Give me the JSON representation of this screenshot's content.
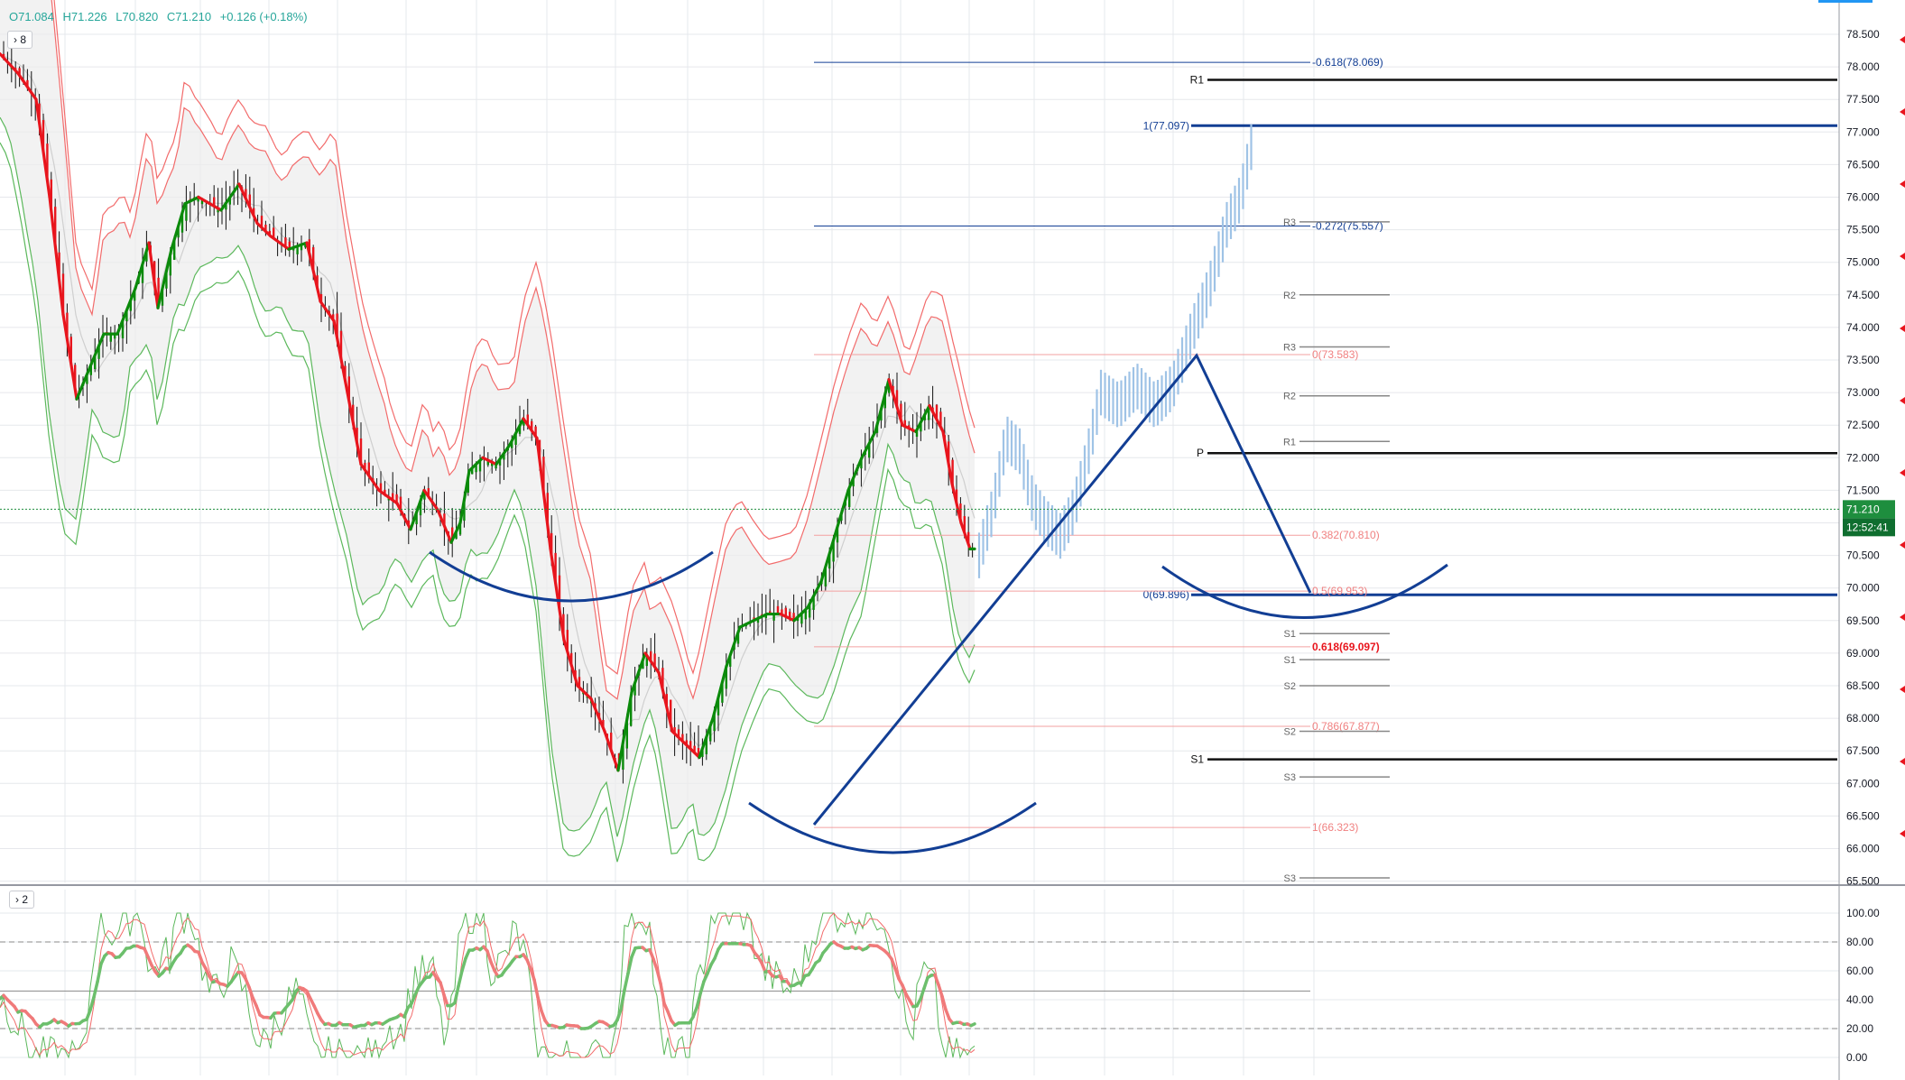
{
  "header": {
    "open": "O71.084",
    "high": "H71.226",
    "low": "L70.820",
    "close": "C71.210",
    "change": "+0.126 (+0.18%)"
  },
  "panes": {
    "main_toggle": "› 8",
    "osc_toggle": "› 2"
  },
  "colors": {
    "up": "#0a8a0a",
    "down": "#e8151d",
    "band_upper": "#f26b6b",
    "band_lower": "#5cb85c",
    "annot": "#123e94",
    "projection": "#9fc3e6",
    "price_tag": "#1e8e3e"
  },
  "price_scale": {
    "labels": [
      "78.500",
      "78.000",
      "77.500",
      "77.000",
      "76.500",
      "76.000",
      "75.500",
      "75.000",
      "74.500",
      "74.000",
      "73.500",
      "73.000",
      "72.500",
      "72.000",
      "71.500",
      "71.000",
      "70.500",
      "70.000",
      "69.500",
      "69.000",
      "68.500",
      "68.000",
      "67.500",
      "67.000",
      "66.500",
      "66.000",
      "65.500"
    ],
    "last_price": "71.210",
    "countdown": "12:52:41"
  },
  "osc_scale": {
    "labels": [
      "100.00",
      "80.00",
      "60.00",
      "40.00",
      "20.00",
      "0.00"
    ]
  },
  "annotations": {
    "fib_ext": [
      {
        "label": "-0.618(78.069)",
        "value": 78.069
      },
      {
        "label": "1(77.097)",
        "value": 77.097
      },
      {
        "label": "-0.272(75.557)",
        "value": 75.557
      },
      {
        "label": "0(69.896)",
        "value": 69.896
      }
    ],
    "fib_ret": [
      {
        "label": "0(73.583)",
        "value": 73.583
      },
      {
        "label": "0.382(70.810)",
        "value": 70.81
      },
      {
        "label": "0.5(69.953)",
        "value": 69.953
      },
      {
        "label": "0.618(69.097)",
        "value": 69.097
      },
      {
        "label": "0.786(67.877)",
        "value": 67.877
      },
      {
        "label": "1(66.323)",
        "value": 66.323
      }
    ],
    "pivots_major": [
      {
        "label": "R1",
        "value": 77.8
      },
      {
        "label": "P",
        "value": 72.07
      },
      {
        "label": "S1",
        "value": 67.37
      }
    ],
    "pivots_minor": [
      {
        "label": "R3",
        "value": 75.62
      },
      {
        "label": "R2",
        "value": 74.5
      },
      {
        "label": "R3",
        "value": 73.7
      },
      {
        "label": "R2",
        "value": 72.95
      },
      {
        "label": "R1",
        "value": 72.25
      },
      {
        "label": "S1",
        "value": 69.3
      },
      {
        "label": "S1",
        "value": 68.9
      },
      {
        "label": "S2",
        "value": 68.5
      },
      {
        "label": "S2",
        "value": 67.8
      },
      {
        "label": "S3",
        "value": 67.1
      },
      {
        "label": "S3",
        "value": 65.55
      }
    ]
  },
  "chart_data": [
    {
      "type": "candlestick",
      "title": "",
      "ylim": [
        65.5,
        78.6
      ],
      "last_price": 71.21,
      "grid": true,
      "close_path": [
        [
          0,
          78.2
        ],
        [
          20,
          77.9
        ],
        [
          40,
          77.5
        ],
        [
          55,
          76.0
        ],
        [
          70,
          74.2
        ],
        [
          85,
          72.9
        ],
        [
          100,
          73.4
        ],
        [
          115,
          73.9
        ],
        [
          130,
          73.9
        ],
        [
          150,
          74.6
        ],
        [
          165,
          75.3
        ],
        [
          175,
          74.3
        ],
        [
          190,
          75.2
        ],
        [
          205,
          75.9
        ],
        [
          220,
          76.0
        ],
        [
          245,
          75.8
        ],
        [
          265,
          76.2
        ],
        [
          285,
          75.6
        ],
        [
          300,
          75.4
        ],
        [
          320,
          75.2
        ],
        [
          340,
          75.3
        ],
        [
          355,
          74.4
        ],
        [
          370,
          74.1
        ],
        [
          385,
          73.0
        ],
        [
          400,
          71.9
        ],
        [
          420,
          71.5
        ],
        [
          440,
          71.3
        ],
        [
          455,
          70.9
        ],
        [
          470,
          71.5
        ],
        [
          485,
          71.2
        ],
        [
          500,
          70.7
        ],
        [
          510,
          71.0
        ],
        [
          520,
          71.8
        ],
        [
          535,
          72.0
        ],
        [
          550,
          71.9
        ],
        [
          565,
          72.2
        ],
        [
          580,
          72.6
        ],
        [
          595,
          72.3
        ],
        [
          610,
          70.6
        ],
        [
          625,
          69.2
        ],
        [
          640,
          68.5
        ],
        [
          655,
          68.3
        ],
        [
          670,
          67.8
        ],
        [
          685,
          67.2
        ],
        [
          700,
          68.4
        ],
        [
          715,
          69.0
        ],
        [
          730,
          68.7
        ],
        [
          745,
          67.8
        ],
        [
          760,
          67.6
        ],
        [
          775,
          67.4
        ],
        [
          790,
          68.0
        ],
        [
          805,
          68.8
        ],
        [
          820,
          69.4
        ],
        [
          835,
          69.5
        ],
        [
          850,
          69.6
        ],
        [
          865,
          69.6
        ],
        [
          880,
          69.5
        ],
        [
          895,
          69.7
        ],
        [
          910,
          70.1
        ],
        [
          925,
          70.8
        ],
        [
          940,
          71.5
        ],
        [
          955,
          72.0
        ],
        [
          970,
          72.4
        ],
        [
          985,
          73.2
        ],
        [
          1000,
          72.5
        ],
        [
          1015,
          72.4
        ],
        [
          1030,
          72.8
        ],
        [
          1045,
          72.4
        ],
        [
          1055,
          71.6
        ],
        [
          1065,
          71.0
        ],
        [
          1075,
          70.6
        ],
        [
          1080,
          70.6
        ]
      ],
      "projection_path": [
        [
          1085,
          70.5
        ],
        [
          1100,
          71.2
        ],
        [
          1115,
          72.3
        ],
        [
          1130,
          72.1
        ],
        [
          1145,
          71.3
        ],
        [
          1160,
          71.0
        ],
        [
          1175,
          70.8
        ],
        [
          1190,
          71.2
        ],
        [
          1205,
          72.0
        ],
        [
          1220,
          73.0
        ],
        [
          1240,
          72.8
        ],
        [
          1260,
          73.1
        ],
        [
          1280,
          72.8
        ],
        [
          1300,
          73.1
        ],
        [
          1320,
          73.9
        ],
        [
          1340,
          74.6
        ],
        [
          1360,
          75.6
        ],
        [
          1375,
          76.0
        ],
        [
          1390,
          77.0
        ]
      ]
    },
    {
      "type": "line",
      "title": "",
      "ylim": [
        0,
        100
      ],
      "levels": [
        80,
        20
      ],
      "grid": true
    }
  ]
}
